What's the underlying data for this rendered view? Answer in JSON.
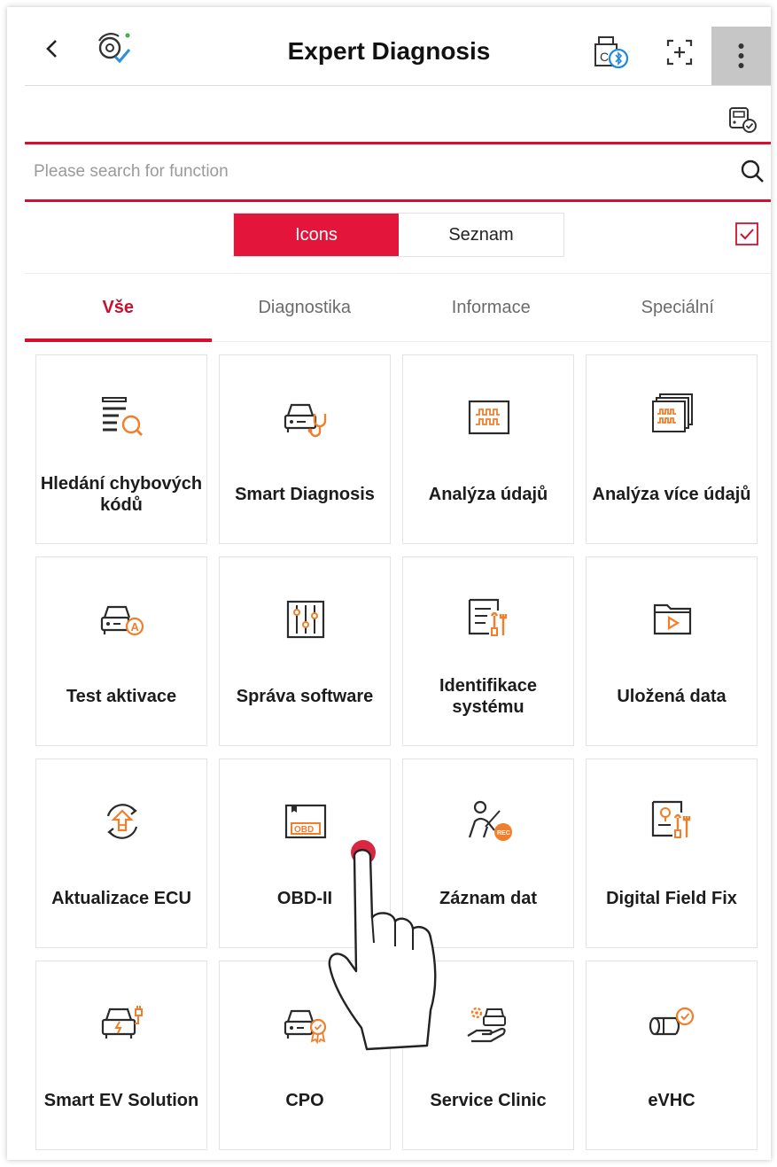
{
  "header": {
    "title": "Expert Diagnosis",
    "icons": [
      "back-arrow-icon",
      "diagnosis-logo-icon",
      "vci-bluetooth-icon",
      "scan-icon",
      "more-icon"
    ]
  },
  "search": {
    "placeholder": "Please search for function",
    "value": ""
  },
  "view_toggle": {
    "icons_label": "Icons",
    "list_label": "Seznam",
    "selected": "Icons"
  },
  "tabs": [
    {
      "label": "Vše",
      "active": true
    },
    {
      "label": "Diagnostika",
      "active": false
    },
    {
      "label": "Informace",
      "active": false
    },
    {
      "label": "Speciální",
      "active": false
    }
  ],
  "functions": [
    {
      "label": "Hledání chybových kódů",
      "icon": "dtc-search-icon"
    },
    {
      "label": "Smart Diagnosis",
      "icon": "car-stethoscope-icon"
    },
    {
      "label": "Analýza údajů",
      "icon": "waveform-icon"
    },
    {
      "label": "Analýza více údajů",
      "icon": "multi-waveform-icon"
    },
    {
      "label": "Test aktivace",
      "icon": "car-activation-icon"
    },
    {
      "label": "Správa software",
      "icon": "sliders-icon"
    },
    {
      "label": "Identifikace systému",
      "icon": "system-id-icon"
    },
    {
      "label": "Uložená data",
      "icon": "folder-play-icon"
    },
    {
      "label": "Aktualizace ECU",
      "icon": "ecu-update-icon"
    },
    {
      "label": "OBD-II",
      "icon": "obd-icon"
    },
    {
      "label": "Záznam dat",
      "icon": "data-record-icon"
    },
    {
      "label": "Digital Field Fix",
      "icon": "field-fix-icon"
    },
    {
      "label": "Smart EV Solution",
      "icon": "ev-car-icon"
    },
    {
      "label": "CPO",
      "icon": "cpo-car-badge-icon"
    },
    {
      "label": "Service Clinic",
      "icon": "service-clinic-icon"
    },
    {
      "label": "eVHC",
      "icon": "evhc-icon"
    }
  ],
  "colors": {
    "accent": "#e4153a",
    "icon_orange": "#f07e2b",
    "icon_dark": "#2b2b2b",
    "toolbar_button_bg": "#c6c6c6"
  }
}
